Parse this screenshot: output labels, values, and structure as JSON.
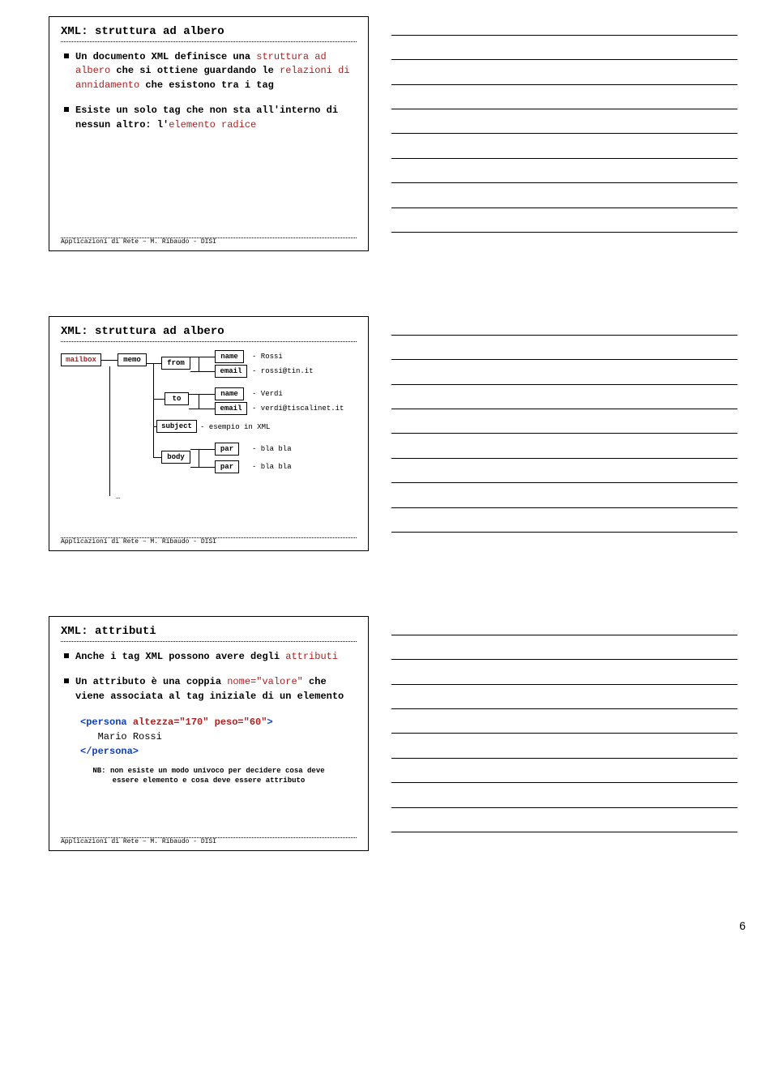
{
  "page_number": "6",
  "footer": "Applicazioni di Rete – M. Ribaudo - DISI",
  "slide1": {
    "title": "XML: struttura ad albero",
    "bullet1_a": "Un documento XML definisce una",
    "bullet1_b": "struttura ad albero",
    "bullet1_c": " che si ottiene guardando le ",
    "bullet1_d": "relazioni di annidamento",
    "bullet1_e": " che esistono tra i tag",
    "bullet2_a": "Esiste un solo tag che non sta all'interno di nessun altro: l'",
    "bullet2_b": "elemento radice"
  },
  "slide2": {
    "title": "XML: struttura ad albero",
    "nodes": {
      "mailbox": "mailbox",
      "memo": "memo",
      "from": "from",
      "to": "to",
      "subject": "subject",
      "body": "body",
      "name": "name",
      "email": "email",
      "par": "par"
    },
    "vals": {
      "rossi": "- Rossi",
      "rossi_email": "- rossi@tin.it",
      "verdi": "- Verdi",
      "verdi_email": "- verdi@tiscalinet.it",
      "esempio": "- esempio in XML",
      "bla1": "- bla bla",
      "bla2": "- bla bla"
    },
    "ellipsis": "…"
  },
  "slide3": {
    "title": "XML: attributi",
    "bullet1_a": "Anche i tag XML possono avere degli ",
    "bullet1_b": "attributi",
    "bullet2_a": "Un attributo è una coppia ",
    "bullet2_b": "nome=\"valore\"",
    "bullet2_c": " che viene associata al tag iniziale di un elemento",
    "code_open_a": "<persona ",
    "code_open_b": "altezza=\"170\" peso=\"60\"",
    "code_open_c": ">",
    "code_content": "Mario Rossi",
    "code_close": "</persona>",
    "nb1": "NB: non esiste un modo univoco per decidere cosa deve",
    "nb2": "essere elemento e cosa deve essere attributo"
  }
}
